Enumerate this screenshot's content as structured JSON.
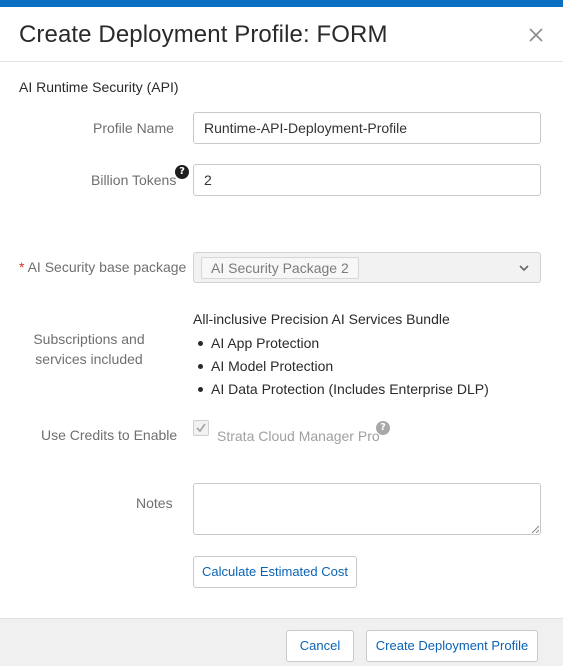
{
  "dialog": {
    "title": "Create Deployment Profile: FORM",
    "close_icon": "close-icon"
  },
  "section": {
    "title": "AI Runtime Security (API)"
  },
  "form": {
    "profile_name": {
      "label": "Profile Name",
      "value": "Runtime-API-Deployment-Profile"
    },
    "billion_tokens": {
      "label": "Billion Tokens",
      "value": "2",
      "help_icon": "question-circle-icon"
    },
    "base_package": {
      "required_marker": "*",
      "label": "AI Security base package",
      "selected": "AI Security Package 2",
      "dropdown_icon": "chevron-down-icon"
    },
    "subscriptions": {
      "label": "Subscriptions and services included",
      "bundle_title": "All-inclusive Precision AI Services Bundle",
      "items": [
        "AI App Protection",
        "AI Model Protection",
        "AI Data Protection (Includes Enterprise DLP)"
      ]
    },
    "credits": {
      "label": "Use Credits to Enable",
      "checkbox_label": "Strata Cloud Manager Pro",
      "checked": true,
      "help_icon": "question-circle-icon"
    },
    "notes": {
      "label": "Notes",
      "value": ""
    },
    "calculate_label": "Calculate Estimated Cost"
  },
  "footer": {
    "cancel_label": "Cancel",
    "submit_label": "Create Deployment Profile"
  },
  "colors": {
    "accent": "#0a6fc2",
    "link": "#0a63b5",
    "required": "#d0312d"
  }
}
